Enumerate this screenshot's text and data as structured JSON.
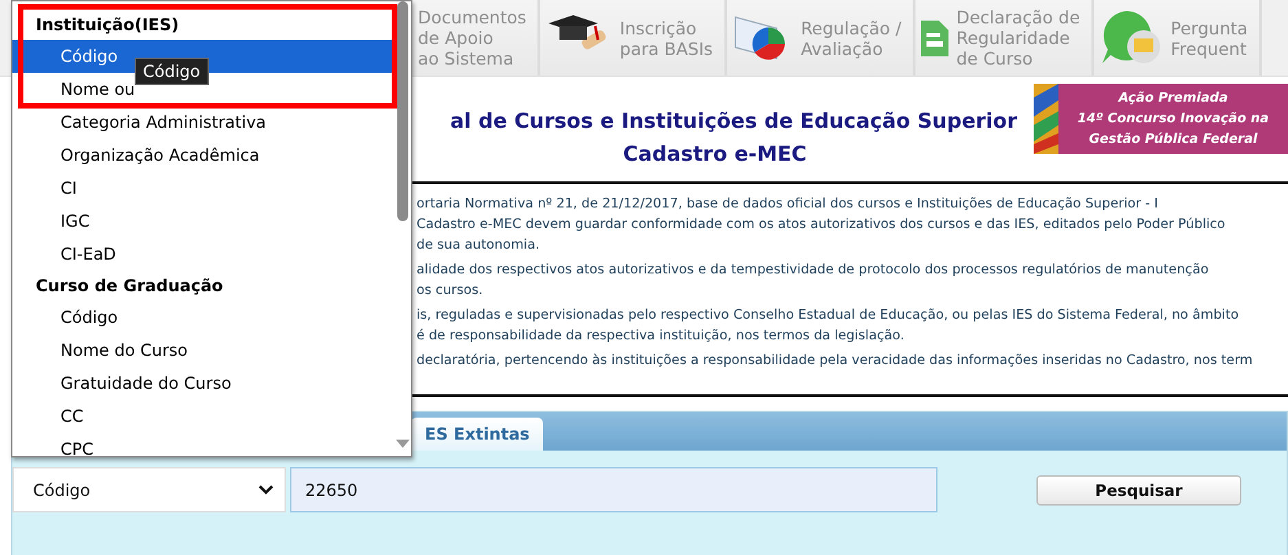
{
  "nav": [
    {
      "kind": "plain",
      "lines": [
        "Documentos",
        "de Apoio",
        "ao Sistema"
      ]
    },
    {
      "kind": "graduation",
      "lines": [
        "Inscrição",
        "para BASIs"
      ]
    },
    {
      "kind": "chart",
      "lines": [
        "Regulação /",
        "Avaliação"
      ]
    },
    {
      "kind": "document",
      "lines": [
        "Declaração de",
        "Regularidade",
        "de Curso"
      ]
    },
    {
      "kind": "question",
      "lines": [
        "Pergunta",
        "Frequent"
      ]
    }
  ],
  "page_title": [
    "al de Cursos e Instituições de Educação Superior",
    "Cadastro e-MEC"
  ],
  "banner": {
    "lines": [
      "Ação Premiada",
      "14º Concurso Inovação na",
      "Gestão Pública Federal"
    ]
  },
  "notice": [
    [
      "ortaria Normativa nº 21, de 21/12/2017, base de dados oficial dos cursos e Instituições de Educação Superior - I",
      "Cadastro e-MEC devem guardar conformidade com os atos autorizativos dos cursos e das IES, editados pelo Poder Público",
      "de sua autonomia."
    ],
    [
      "alidade dos respectivos atos autorizativos e da tempestividade de protocolo dos processos regulatórios de manutenção",
      "os cursos."
    ],
    [
      "is, reguladas e supervisionadas pelo respectivo Conselho Estadual de Educação, ou pelas IES do Sistema Federal, no âmbito",
      "é de responsabilidade da respectiva instituição, nos termos da legislação."
    ],
    [
      "declaratória, pertencendo às instituições a responsabilidade pela veracidade das informações inseridas no Cadastro, nos term"
    ]
  ],
  "tabs": [
    {
      "label": "ES Extintas",
      "selected": true
    }
  ],
  "search": {
    "select": "Código",
    "value": "22650",
    "button": "Pesquisar"
  },
  "dropdown": {
    "groups": [
      {
        "label": "Instituição(IES)",
        "options": [
          {
            "label": "Código",
            "selected": true
          },
          {
            "label": "Nome ou",
            "selected": false
          },
          {
            "label": "Categoria Administrativa",
            "selected": false
          },
          {
            "label": "Organização Acadêmica",
            "selected": false
          },
          {
            "label": "CI",
            "selected": false
          },
          {
            "label": "IGC",
            "selected": false
          },
          {
            "label": "CI-EaD",
            "selected": false
          }
        ]
      },
      {
        "label": "Curso de Graduação",
        "options": [
          {
            "label": "Código",
            "selected": false
          },
          {
            "label": "Nome do Curso",
            "selected": false
          },
          {
            "label": "Gratuidade do Curso",
            "selected": false
          },
          {
            "label": "CC",
            "selected": false
          },
          {
            "label": "CPC",
            "selected": false
          }
        ]
      }
    ]
  },
  "tooltip": "Código"
}
